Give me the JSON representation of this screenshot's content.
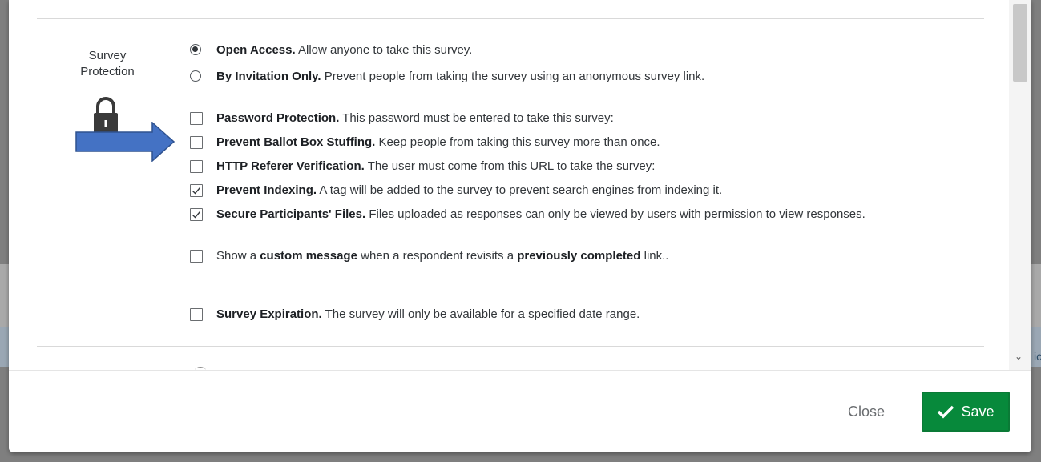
{
  "section": {
    "label": "Survey Protection"
  },
  "access_options": [
    {
      "bold": "Open Access.",
      "text": " Allow anyone to take this survey.",
      "selected": true
    },
    {
      "bold": "By Invitation Only.",
      "text": " Prevent people from taking the survey using an anonymous survey link.",
      "selected": false
    }
  ],
  "checkbox_options": [
    {
      "bold": "Password Protection.",
      "text": " This password must be entered to take this survey:",
      "checked": false
    },
    {
      "bold": "Prevent Ballot Box Stuffing.",
      "text": " Keep people from taking this survey more than once.",
      "checked": false
    },
    {
      "bold": "HTTP Referer Verification.",
      "text": " The user must come from this URL to take the survey:",
      "checked": false
    },
    {
      "bold": "Prevent Indexing.",
      "text": " A tag will be added to the survey to prevent search engines from indexing it.",
      "checked": true
    },
    {
      "bold": "Secure Participants' Files.",
      "text": " Files uploaded as responses can only be viewed by users with permission to view responses.",
      "checked": true
    }
  ],
  "custom_message": {
    "part1": "Show a ",
    "bold1": "custom message",
    "part2": " when a respondent revisits a ",
    "bold2": "previously completed",
    "part3": " link..",
    "checked": false
  },
  "expiration": {
    "bold": "Survey Expiration.",
    "text": " The survey will only be available for a specified date range.",
    "checked": false
  },
  "footer": {
    "close_label": "Close",
    "save_label": "Save"
  },
  "peek": {
    "text": "ic"
  },
  "colors": {
    "save": "#07893b",
    "arrow": "#4472c4",
    "lock": "#3a3a3a"
  }
}
